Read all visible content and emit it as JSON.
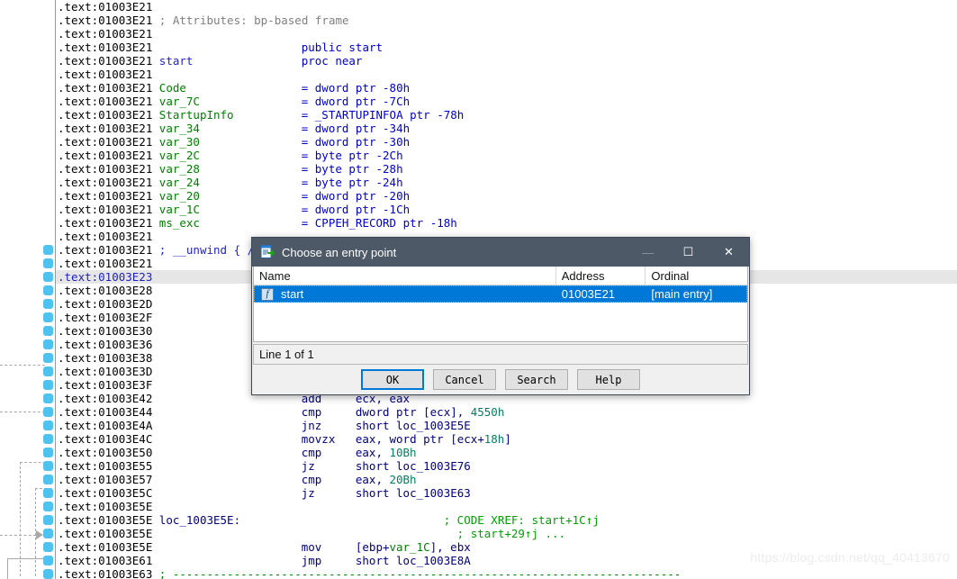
{
  "app": {
    "name": "IDA Pro disassembly view"
  },
  "watermark": "https://blog.csdn.net/qq_40413670",
  "dialog": {
    "title": "Choose an entry point",
    "title_icon": "entry-point-icon",
    "window_buttons": {
      "minimize": "—",
      "maximize": "☐",
      "close": "✕"
    },
    "columns": [
      "Name",
      "Address",
      "Ordinal"
    ],
    "rows": [
      {
        "icon": "function-icon",
        "name": "start",
        "address": "01003E21",
        "ordinal": "[main entry]"
      }
    ],
    "status": "Line 1 of 1",
    "buttons": [
      "OK",
      "Cancel",
      "Search",
      "Help"
    ],
    "accent_color": "#0078d7",
    "titlebar_color": "#4d5966"
  },
  "code": {
    "lines": [
      {
        "addr": ".text:01003E21",
        "hl": false,
        "parts": []
      },
      {
        "addr": ".text:01003E21",
        "hl": false,
        "parts": [
          {
            "t": "; Attributes: bp-based frame",
            "c": "gray",
            "col": 0
          }
        ]
      },
      {
        "addr": ".text:01003E21",
        "hl": false,
        "parts": []
      },
      {
        "addr": ".text:01003E21",
        "hl": false,
        "parts": [
          {
            "t": "public start",
            "c": "kw",
            "col": 21
          }
        ]
      },
      {
        "addr": ".text:01003E21",
        "hl": false,
        "parts": [
          {
            "t": "start",
            "c": "blue",
            "col": 0
          },
          {
            "t": "proc near",
            "c": "kw",
            "col": 21
          }
        ]
      },
      {
        "addr": ".text:01003E21",
        "hl": false,
        "parts": []
      },
      {
        "addr": ".text:01003E21",
        "hl": false,
        "parts": [
          {
            "t": "Code",
            "c": "name",
            "col": 0
          },
          {
            "t": "= dword ptr -80h",
            "c": "kw",
            "col": 21
          }
        ]
      },
      {
        "addr": ".text:01003E21",
        "hl": false,
        "parts": [
          {
            "t": "var_7C",
            "c": "name",
            "col": 0
          },
          {
            "t": "= dword ptr -7Ch",
            "c": "kw",
            "col": 21
          }
        ]
      },
      {
        "addr": ".text:01003E21",
        "hl": false,
        "parts": [
          {
            "t": "StartupInfo",
            "c": "name",
            "col": 0
          },
          {
            "t": "= _STARTUPINFOA ptr -78h",
            "c": "kw",
            "col": 21
          }
        ]
      },
      {
        "addr": ".text:01003E21",
        "hl": false,
        "parts": [
          {
            "t": "var_34",
            "c": "name",
            "col": 0
          },
          {
            "t": "= dword ptr -34h",
            "c": "kw",
            "col": 21
          }
        ]
      },
      {
        "addr": ".text:01003E21",
        "hl": false,
        "parts": [
          {
            "t": "var_30",
            "c": "name",
            "col": 0
          },
          {
            "t": "= dword ptr -30h",
            "c": "kw",
            "col": 21
          }
        ]
      },
      {
        "addr": ".text:01003E21",
        "hl": false,
        "parts": [
          {
            "t": "var_2C",
            "c": "name",
            "col": 0
          },
          {
            "t": "= byte ptr -2Ch",
            "c": "kw",
            "col": 21
          }
        ]
      },
      {
        "addr": ".text:01003E21",
        "hl": false,
        "parts": [
          {
            "t": "var_28",
            "c": "name",
            "col": 0
          },
          {
            "t": "= byte ptr -28h",
            "c": "kw",
            "col": 21
          }
        ]
      },
      {
        "addr": ".text:01003E21",
        "hl": false,
        "parts": [
          {
            "t": "var_24",
            "c": "name",
            "col": 0
          },
          {
            "t": "= byte ptr -24h",
            "c": "kw",
            "col": 21
          }
        ]
      },
      {
        "addr": ".text:01003E21",
        "hl": false,
        "parts": [
          {
            "t": "var_20",
            "c": "name",
            "col": 0
          },
          {
            "t": "= dword ptr -20h",
            "c": "kw",
            "col": 21
          }
        ]
      },
      {
        "addr": ".text:01003E21",
        "hl": false,
        "parts": [
          {
            "t": "var_1C",
            "c": "name",
            "col": 0
          },
          {
            "t": "= dword ptr -1Ch",
            "c": "kw",
            "col": 21
          }
        ]
      },
      {
        "addr": ".text:01003E21",
        "hl": false,
        "parts": [
          {
            "t": "ms_exc",
            "c": "name",
            "col": 0
          },
          {
            "t": "= CPPEH_RECORD ptr -18h",
            "c": "kw",
            "col": 21
          }
        ]
      },
      {
        "addr": ".text:01003E21",
        "hl": false,
        "parts": []
      },
      {
        "addr": ".text:01003E21",
        "hl": false,
        "parts": [
          {
            "t": "; __unwind { //",
            "c": "blue",
            "col": 0
          }
        ]
      },
      {
        "addr": ".text:01003E21",
        "hl": false,
        "parts": []
      },
      {
        "addr": ".text:01003E23",
        "hl": true,
        "parts": []
      },
      {
        "addr": ".text:01003E28",
        "hl": false,
        "parts": []
      },
      {
        "addr": ".text:01003E2D",
        "hl": false,
        "parts": []
      },
      {
        "addr": ".text:01003E2F",
        "hl": false,
        "parts": []
      },
      {
        "addr": ".text:01003E30",
        "hl": false,
        "parts": []
      },
      {
        "addr": ".text:01003E36",
        "hl": false,
        "parts": []
      },
      {
        "addr": ".text:01003E38",
        "hl": false,
        "parts": []
      },
      {
        "addr": ".text:01003E3D",
        "hl": false,
        "parts": []
      },
      {
        "addr": ".text:01003E3F",
        "hl": false,
        "parts": []
      },
      {
        "addr": ".text:01003E42",
        "hl": false,
        "parts": [
          {
            "t": "add",
            "c": "mn",
            "col": 21
          },
          {
            "t": "ecx, eax",
            "c": "mn",
            "col": 29
          }
        ]
      },
      {
        "addr": ".text:01003E44",
        "hl": false,
        "parts": [
          {
            "t": "cmp",
            "c": "mn",
            "col": 21
          },
          {
            "t": "dword ptr [ecx], ",
            "c": "mn",
            "col": 29
          },
          {
            "t": "4550h",
            "c": "num",
            "col": 46
          }
        ]
      },
      {
        "addr": ".text:01003E4A",
        "hl": false,
        "parts": [
          {
            "t": "jnz",
            "c": "mn",
            "col": 21
          },
          {
            "t": "short loc_1003E5E",
            "c": "mn",
            "col": 29
          }
        ]
      },
      {
        "addr": ".text:01003E4C",
        "hl": false,
        "parts": [
          {
            "t": "movzx",
            "c": "mn",
            "col": 21
          },
          {
            "t": "eax, word ptr [ecx+",
            "c": "mn",
            "col": 29
          },
          {
            "t": "18h",
            "c": "num",
            "col": 48
          },
          {
            "t": "]",
            "c": "mn",
            "col": 51
          }
        ]
      },
      {
        "addr": ".text:01003E50",
        "hl": false,
        "parts": [
          {
            "t": "cmp",
            "c": "mn",
            "col": 21
          },
          {
            "t": "eax, ",
            "c": "mn",
            "col": 29
          },
          {
            "t": "10Bh",
            "c": "num",
            "col": 34
          }
        ]
      },
      {
        "addr": ".text:01003E55",
        "hl": false,
        "parts": [
          {
            "t": "jz",
            "c": "mn",
            "col": 21
          },
          {
            "t": "short loc_1003E76",
            "c": "mn",
            "col": 29
          }
        ]
      },
      {
        "addr": ".text:01003E57",
        "hl": false,
        "parts": [
          {
            "t": "cmp",
            "c": "mn",
            "col": 21
          },
          {
            "t": "eax, ",
            "c": "mn",
            "col": 29
          },
          {
            "t": "20Bh",
            "c": "num",
            "col": 34
          }
        ]
      },
      {
        "addr": ".text:01003E5C",
        "hl": false,
        "parts": [
          {
            "t": "jz",
            "c": "mn",
            "col": 21
          },
          {
            "t": "short loc_1003E63",
            "c": "mn",
            "col": 29
          }
        ]
      },
      {
        "addr": ".text:01003E5E",
        "hl": false,
        "parts": []
      },
      {
        "addr": ".text:01003E5E",
        "hl": false,
        "parts": [
          {
            "t": "loc_1003E5E:",
            "c": "mn",
            "col": 0
          },
          {
            "t": "; CODE XREF: start+1C↑j",
            "c": "cmt",
            "col": 42
          }
        ]
      },
      {
        "addr": ".text:01003E5E",
        "hl": false,
        "parts": [
          {
            "t": "; start+29↑j ...",
            "c": "cmt",
            "col": 44
          }
        ]
      },
      {
        "addr": ".text:01003E5E",
        "hl": false,
        "parts": [
          {
            "t": "mov",
            "c": "mn",
            "col": 21
          },
          {
            "t": "[ebp+",
            "c": "mn",
            "col": 29
          },
          {
            "t": "var_1C",
            "c": "name",
            "col": 34
          },
          {
            "t": "], ebx",
            "c": "mn",
            "col": 40
          }
        ]
      },
      {
        "addr": ".text:01003E61",
        "hl": false,
        "parts": [
          {
            "t": "jmp",
            "c": "mn",
            "col": 21
          },
          {
            "t": "short loc_1003E8A",
            "c": "mn",
            "col": 29
          }
        ]
      },
      {
        "addr": ".text:01003E63",
        "hl": false,
        "parts": [
          {
            "t": "; ---------------------------------------------------------------------------",
            "c": "dash",
            "col": 0
          }
        ]
      }
    ]
  },
  "gutter": {
    "breakpoint_color": "#4ec3f0",
    "graph_line_color": "#a8a8a8",
    "breakpoint_rows": [
      18,
      19,
      20,
      21,
      22,
      23,
      24,
      25,
      26,
      27,
      28,
      29,
      30,
      31,
      32,
      33,
      34,
      35,
      36,
      37,
      38,
      39,
      40,
      41,
      42
    ]
  }
}
